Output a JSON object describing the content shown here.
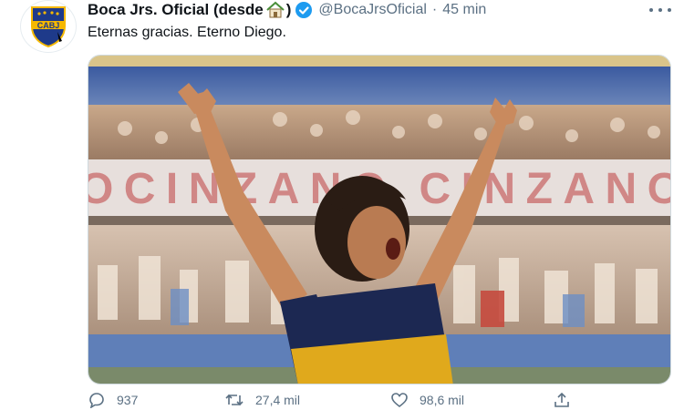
{
  "tweet": {
    "display_name": "Boca Jrs. Oficial (desde",
    "display_name_close": ")",
    "handle": "@BocaJrsOficial",
    "separator": "·",
    "time": "45 min",
    "text": "Eternas gracias. Eterno Diego.",
    "avatar": {
      "logo_text": "CABJ",
      "icon": "boca-crest-icon"
    },
    "name_emoji": "house-icon",
    "verified": true
  },
  "media": {
    "banner_text": "OCINZANO  CINZANO",
    "description_icon": "photo"
  },
  "actions": {
    "reply_count": "937",
    "retweet_count": "27,4 mil",
    "like_count": "98,6 mil"
  },
  "colors": {
    "boca_blue": "#1e3a8a",
    "boca_yellow": "#f5b800",
    "secondary_text": "#5b7083",
    "verified": "#1d9bf0"
  }
}
